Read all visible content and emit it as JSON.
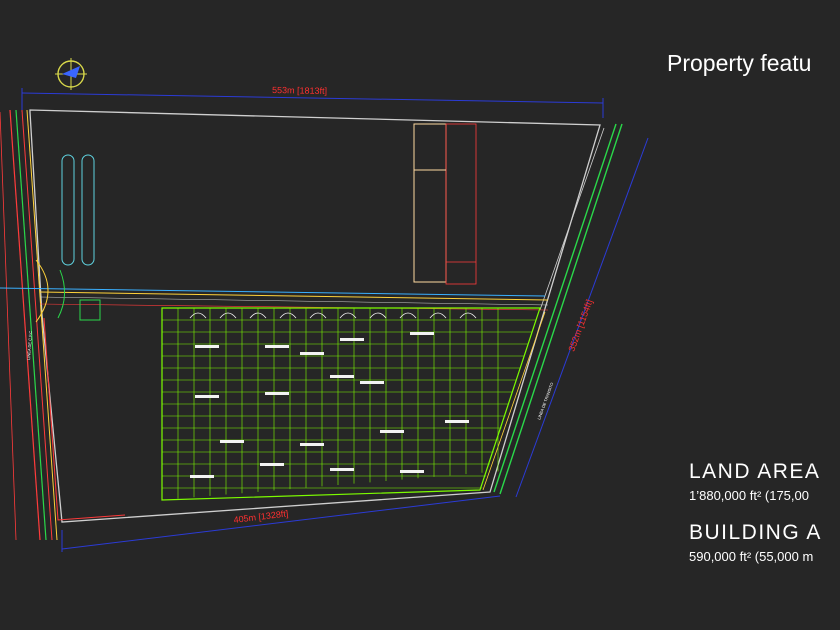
{
  "slide": {
    "title": "Property featu",
    "land_area_heading": "LAND AREA",
    "land_area_value": "1’880,000 ft² (175,00",
    "building_area_heading": "BUILDING A",
    "building_area_value": "590,000 ft² (55,000 m"
  },
  "plan": {
    "dim_top": "553m  [1813ft]",
    "dim_bottom": "405m  [1328ft]",
    "dim_right": "352m  [1154ft]",
    "road_label_left": "LINEA DE C.F.C",
    "road_label_right": "LINEA DE TRANSITO"
  },
  "colors": {
    "background": "#262626",
    "grid_green": "#7CFC00",
    "dimension_blue": "#2b3bd6",
    "dimension_text": "#ff3030"
  }
}
